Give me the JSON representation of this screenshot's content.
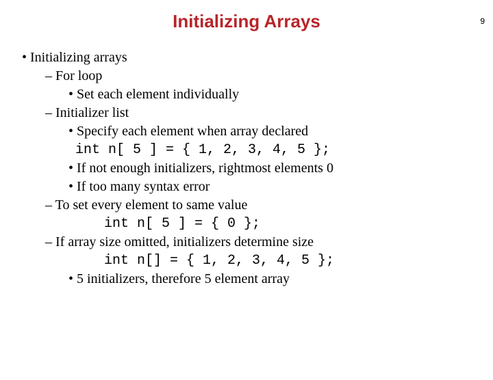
{
  "page_number": "9",
  "title": "Initializing Arrays",
  "bullets": {
    "main": "Initializing arrays",
    "sub1": "For loop",
    "sub1_1": "Set each element individually",
    "sub2": "Initializer list",
    "sub2_1": "Specify each element when array declared",
    "sub2_code": "int n[ 5 ] = { 1, 2, 3, 4, 5 };",
    "sub2_2": "If not enough initializers, rightmost elements 0",
    "sub2_3": "If too many syntax error",
    "sub3": "To set every element to same value",
    "sub3_code": "int n[ 5 ] = { 0 };",
    "sub4": "If array size omitted, initializers determine size",
    "sub4_code": "int n[] = { 1, 2, 3, 4, 5 };",
    "sub4_1": "5 initializers, therefore 5 element array"
  }
}
